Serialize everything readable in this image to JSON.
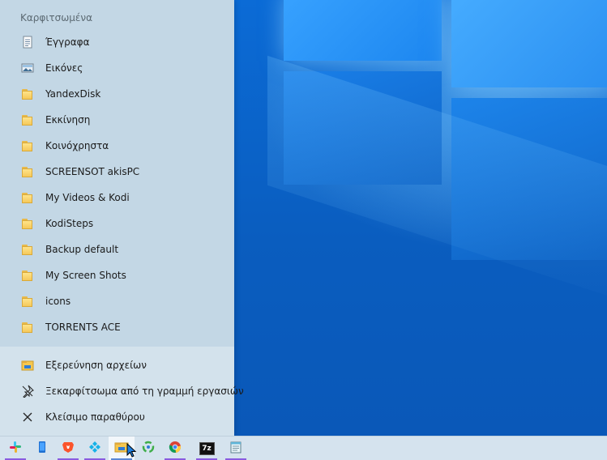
{
  "jumplist": {
    "header": "Καρφιτσωμένα",
    "pinned": [
      {
        "label": "Έγγραφα",
        "icon": "documents-icon"
      },
      {
        "label": "Εικόνες",
        "icon": "pictures-icon"
      },
      {
        "label": "YandexDisk",
        "icon": "folder-icon"
      },
      {
        "label": "Εκκίνηση",
        "icon": "folder-icon"
      },
      {
        "label": "Κοινόχρηστα",
        "icon": "folder-icon"
      },
      {
        "label": "SCREENSOT akisPC",
        "icon": "folder-icon"
      },
      {
        "label": "My Videos & Kodi",
        "icon": "folder-icon"
      },
      {
        "label": "KodiSteps",
        "icon": "folder-icon"
      },
      {
        "label": "Backup default",
        "icon": "folder-icon"
      },
      {
        "label": "My Screen Shots",
        "icon": "folder-icon"
      },
      {
        "label": "icons",
        "icon": "folder-icon"
      },
      {
        "label": "TORRENTS ACE",
        "icon": "folder-icon"
      }
    ],
    "actions": [
      {
        "label": "Εξερεύνηση αρχείων",
        "icon": "file-explorer-icon"
      },
      {
        "label": "Ξεκαρφίτσωμα από τη γραμμή εργασιών",
        "icon": "unpin-icon"
      },
      {
        "label": "Κλείσιμο παραθύρου",
        "icon": "close-icon"
      }
    ]
  },
  "taskbar": {
    "apps": [
      {
        "name": "slack-icon"
      },
      {
        "name": "phone-app-icon"
      },
      {
        "name": "brave-icon"
      },
      {
        "name": "kodi-icon"
      },
      {
        "name": "file-explorer-icon",
        "active": true
      },
      {
        "name": "recycle-app-icon"
      },
      {
        "name": "chrome-icon"
      },
      {
        "name": "7zip-icon",
        "text": "7z"
      },
      {
        "name": "notepad-icon"
      }
    ]
  },
  "colors": {
    "jumplist_bg": "#c3d7e5",
    "taskbar_bg": "#d5e3ee",
    "desktop_blue": "#0a5fc4",
    "running_indicator": "#8a5be0"
  }
}
